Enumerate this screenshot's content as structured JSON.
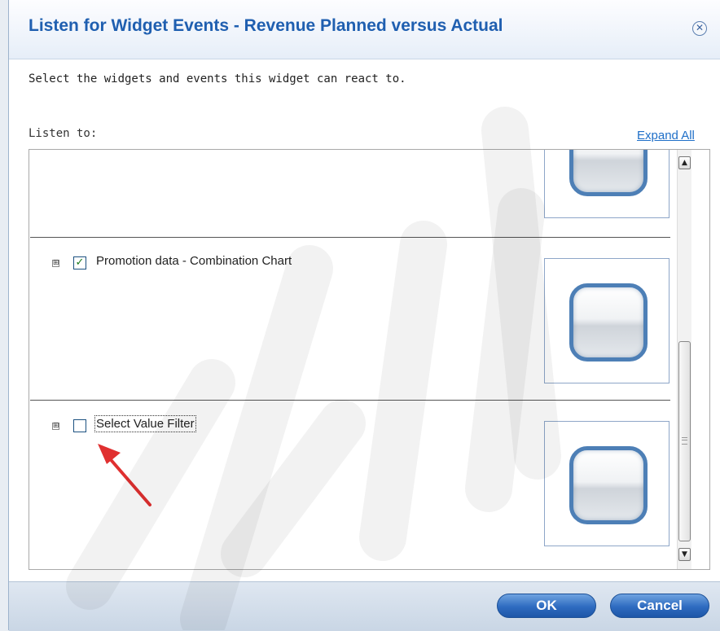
{
  "dialog": {
    "title": "Listen for Widget Events - Revenue Planned versus Actual",
    "close_icon": "close-circle-icon",
    "instructions": "Select the widgets and events this widget can react to.",
    "listen_label": "Listen to:",
    "expand_all": "Expand All"
  },
  "widgets": [
    {
      "label": "Promotion data - Combination Chart",
      "checked": true,
      "expand_glyph": "⊞",
      "check_glyph": "✓"
    },
    {
      "label": "Select Value Filter",
      "checked": false,
      "expand_glyph": "⊞",
      "check_glyph": ""
    }
  ],
  "footer": {
    "ok": "OK",
    "cancel": "Cancel"
  },
  "scrollbar": {
    "up": "▲",
    "down": "▼"
  },
  "colors": {
    "title": "#1f5fb0",
    "button": "#2e6bc0",
    "annotation_arrow": "#e03030",
    "link": "#1f6fc8"
  }
}
